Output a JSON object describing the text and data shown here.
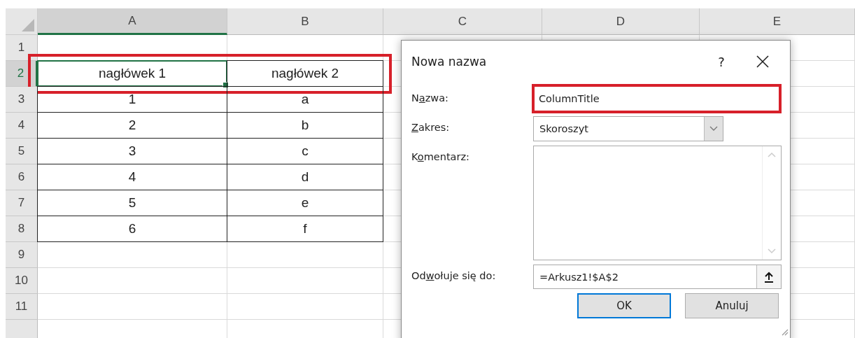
{
  "sheet": {
    "columns": [
      {
        "label": "A",
        "selected": true
      },
      {
        "label": "B",
        "selected": false
      },
      {
        "label": "C",
        "selected": false
      },
      {
        "label": "D",
        "selected": false
      },
      {
        "label": "E",
        "selected": false
      }
    ],
    "rows": [
      {
        "number": "1",
        "selected": false,
        "cells": [
          {
            "text": "",
            "bordered": false,
            "selected": false
          },
          {
            "text": "",
            "bordered": false,
            "selected": false
          }
        ]
      },
      {
        "number": "2",
        "selected": true,
        "annotated": true,
        "cells": [
          {
            "text": "nagłówek 1",
            "bordered": true,
            "selected": true
          },
          {
            "text": "nagłówek 2",
            "bordered": true,
            "selected": false
          }
        ]
      },
      {
        "number": "3",
        "selected": false,
        "cells": [
          {
            "text": "1",
            "bordered": true,
            "selected": false
          },
          {
            "text": "a",
            "bordered": true,
            "selected": false
          }
        ]
      },
      {
        "number": "4",
        "selected": false,
        "cells": [
          {
            "text": "2",
            "bordered": true,
            "selected": false
          },
          {
            "text": "b",
            "bordered": true,
            "selected": false
          }
        ]
      },
      {
        "number": "5",
        "selected": false,
        "cells": [
          {
            "text": "3",
            "bordered": true,
            "selected": false
          },
          {
            "text": "c",
            "bordered": true,
            "selected": false
          }
        ]
      },
      {
        "number": "6",
        "selected": false,
        "cells": [
          {
            "text": "4",
            "bordered": true,
            "selected": false
          },
          {
            "text": "d",
            "bordered": true,
            "selected": false
          }
        ]
      },
      {
        "number": "7",
        "selected": false,
        "cells": [
          {
            "text": "5",
            "bordered": true,
            "selected": false
          },
          {
            "text": "e",
            "bordered": true,
            "selected": false
          }
        ]
      },
      {
        "number": "8",
        "selected": false,
        "cells": [
          {
            "text": "6",
            "bordered": true,
            "selected": false
          },
          {
            "text": "f",
            "bordered": true,
            "selected": false
          }
        ]
      },
      {
        "number": "9",
        "selected": false,
        "cells": [
          {
            "text": "",
            "bordered": false,
            "selected": false
          },
          {
            "text": "",
            "bordered": false,
            "selected": false
          }
        ]
      },
      {
        "number": "10",
        "selected": false,
        "cells": [
          {
            "text": "",
            "bordered": false,
            "selected": false
          },
          {
            "text": "",
            "bordered": false,
            "selected": false
          }
        ]
      },
      {
        "number": "11",
        "selected": false,
        "cells": [
          {
            "text": "",
            "bordered": false,
            "selected": false
          },
          {
            "text": "",
            "bordered": false,
            "selected": false
          }
        ]
      }
    ]
  },
  "dialog": {
    "title": "Nowa nazwa",
    "help": "?",
    "fields": [
      {
        "kind": "text",
        "label": {
          "before": "N",
          "key": "a",
          "after": "zwa:"
        },
        "value": "ColumnTitle",
        "annotated": true
      },
      {
        "kind": "select",
        "label": {
          "key": "Z",
          "after": "akres:"
        },
        "value": "Skoroszyt",
        "annotated": false
      },
      {
        "kind": "textarea",
        "label": {
          "before": "K",
          "key": "o",
          "after": "mentarz:"
        },
        "annotated": false
      },
      {
        "kind": "reference",
        "label": {
          "before": "Od",
          "key": "w",
          "after": "ołuje się do:"
        },
        "value": "=Arkusz1!$A$2",
        "annotated": false
      }
    ],
    "buttons": [
      {
        "label": "OK",
        "default": true
      },
      {
        "label": "Anuluj",
        "default": false
      }
    ]
  }
}
